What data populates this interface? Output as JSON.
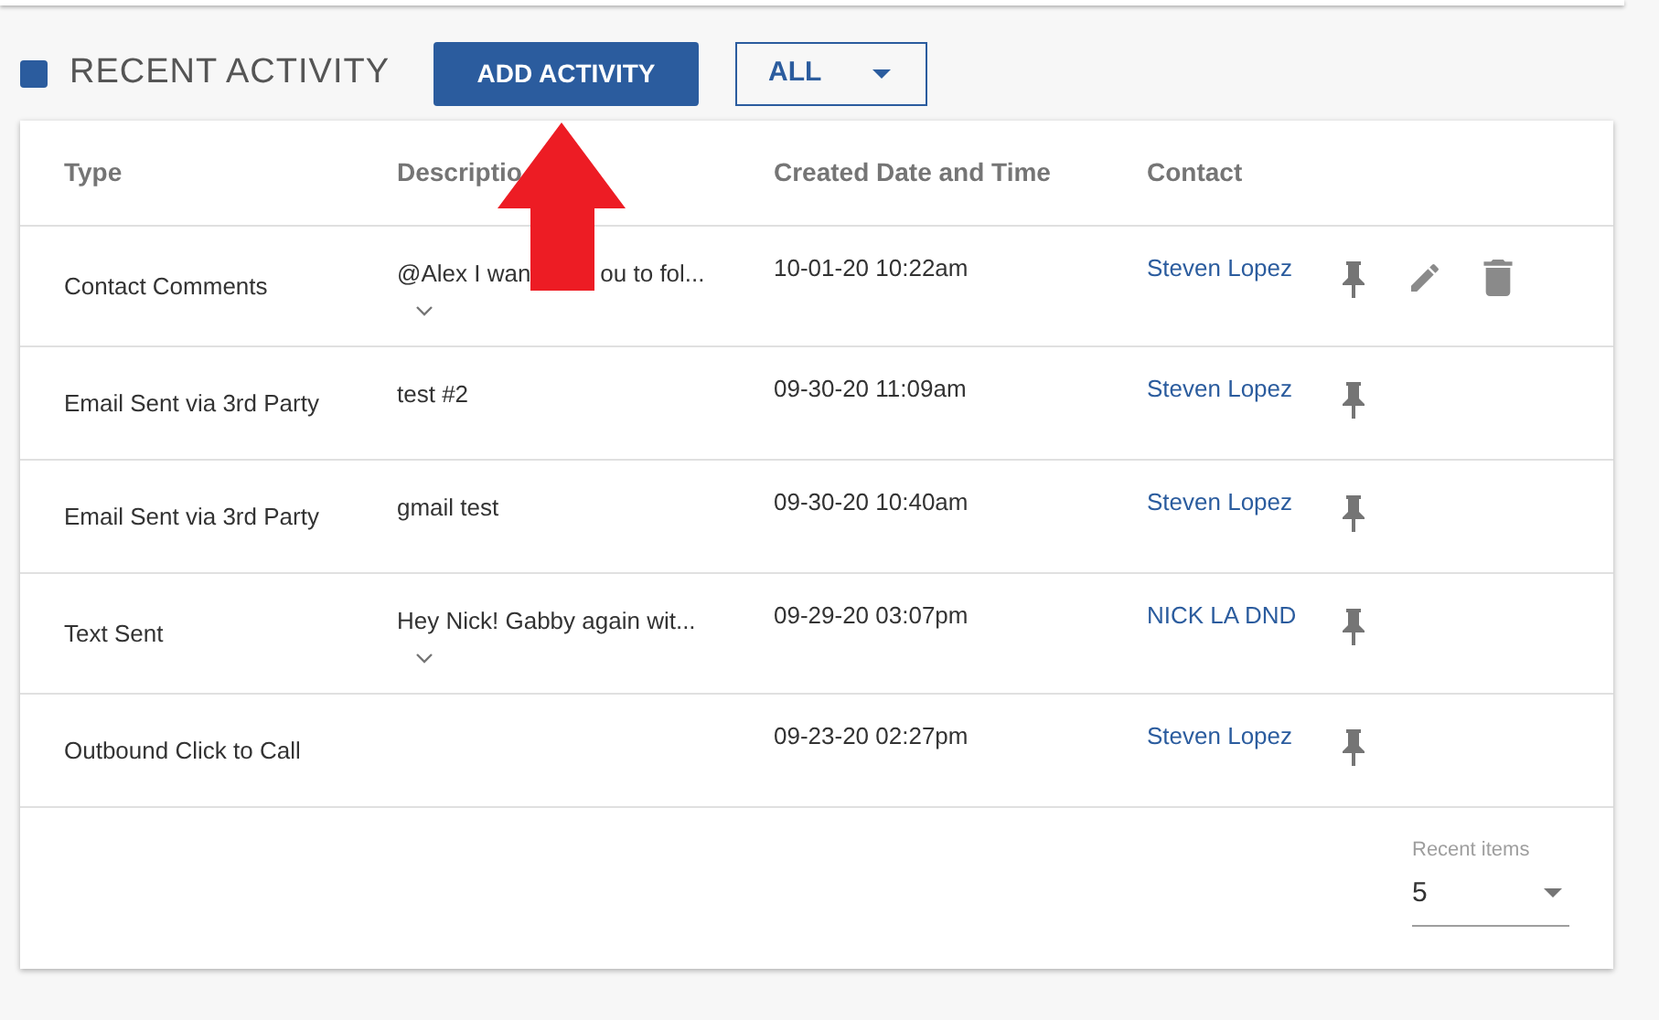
{
  "section": {
    "title": "RECENT ACTIVITY"
  },
  "add_button": "ADD ACTIVITY",
  "filter": {
    "value": "ALL"
  },
  "table": {
    "columns": [
      "Type",
      "Descriptio",
      "Created Date and Time",
      "Contact"
    ],
    "rows": [
      {
        "type": "Contact Comments",
        "description": [
          "@Alex I wan",
          "ou to fol..."
        ],
        "expandable": true,
        "date": "10-01-20 10:22am",
        "contact": "Steven Lopez",
        "editable": true,
        "deletable": true
      },
      {
        "type": "Email Sent via 3rd Party",
        "description": [
          "test #2"
        ],
        "expandable": false,
        "date": "09-30-20 11:09am",
        "contact": "Steven Lopez",
        "editable": false,
        "deletable": false
      },
      {
        "type": "Email Sent via 3rd Party",
        "description": [
          "gmail test"
        ],
        "expandable": false,
        "date": "09-30-20 10:40am",
        "contact": "Steven Lopez",
        "editable": false,
        "deletable": false
      },
      {
        "type": "Text Sent",
        "description": [
          "Hey Nick! Gabby again wit..."
        ],
        "expandable": true,
        "date": "09-29-20 03:07pm",
        "contact": "NICK LA DND",
        "editable": false,
        "deletable": false
      },
      {
        "type": "Outbound Click to Call",
        "expandable": false,
        "date": "09-23-20 02:27pm",
        "contact": "Steven Lopez",
        "editable": false,
        "deletable": false
      }
    ]
  },
  "recent_items": {
    "label": "Recent items",
    "value": "5"
  },
  "annotation": {
    "kind": "arrow"
  }
}
